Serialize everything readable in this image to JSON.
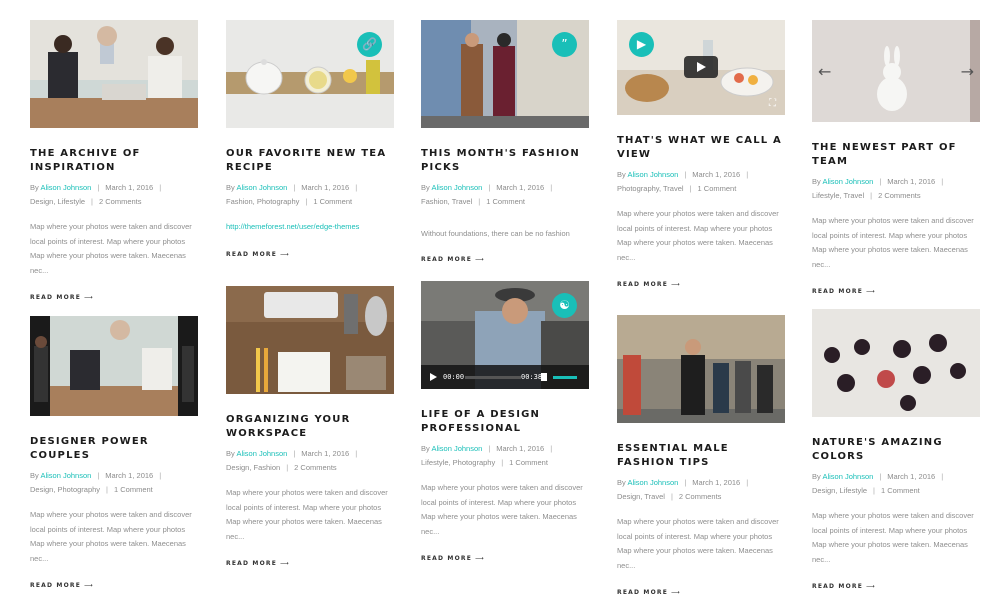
{
  "colors": {
    "accent": "#19bfb8",
    "title": "#1b1b1b",
    "text": "#8f8f8f"
  },
  "posts": [
    {
      "title": "THE ARCHIVE OF INSPIRATION",
      "author": "Alison Johnson",
      "date": "March 1, 2016",
      "categories": "Design, Lifestyle",
      "comments": "2 Comments",
      "excerpt": "Map where your photos were taken and discover local points of interest. Map where your photos Map where your photos were taken. Maecenas nec...",
      "read_more": "READ MORE"
    },
    {
      "title": "OUR FAVORITE NEW TEA RECIPE",
      "author": "Alison Johnson",
      "date": "March 1, 2016",
      "categories": "Fashion, Photography",
      "comments": "1 Comment",
      "link": "http://themeforest.net/user/edge-themes",
      "read_more": "READ MORE",
      "badge_icon": "link-icon"
    },
    {
      "title": "THIS MONTH'S FASHION PICKS",
      "author": "Alison Johnson",
      "date": "March 1, 2016",
      "categories": "Fashion, Travel",
      "comments": "1 Comment",
      "quote": "Without foundations, there can be no fashion",
      "read_more": "READ MORE",
      "badge_icon": "quote-icon"
    },
    {
      "title": "THAT'S WHAT WE CALL A VIEW",
      "author": "Alison Johnson",
      "date": "March 1, 2016",
      "categories": "Photography, Travel",
      "comments": "1 Comment",
      "excerpt": "Map where your photos were taken and discover local points of interest. Map where your photos Map where your photos were taken. Maecenas nec...",
      "read_more": "READ MORE",
      "badge_icon": "video-icon"
    },
    {
      "title": "THE NEWEST PART OF TEAM",
      "author": "Alison Johnson",
      "date": "March 1, 2016",
      "categories": "Lifestyle, Travel",
      "comments": "2 Comments",
      "excerpt": "Map where your photos were taken and discover local points of interest. Map where your photos Map where your photos were taken. Maecenas nec...",
      "read_more": "READ MORE"
    },
    {
      "title": "DESIGNER POWER COUPLES",
      "author": "Alison Johnson",
      "date": "March 1, 2016",
      "categories": "Design, Photography",
      "comments": "1 Comment",
      "excerpt": "Map where your photos were taken and discover local points of interest. Map where your photos Map where your photos were taken. Maecenas nec...",
      "read_more": "READ MORE"
    },
    {
      "title": "ORGANIZING YOUR WORKSPACE",
      "author": "Alison Johnson",
      "date": "March 1, 2016",
      "categories": "Design, Fashion",
      "comments": "2 Comments",
      "excerpt": "Map where your photos were taken and discover local points of interest. Map where your photos Map where your photos were taken. Maecenas nec...",
      "read_more": "READ MORE"
    },
    {
      "title": "LIFE OF A DESIGN PROFESSIONAL",
      "author": "Alison Johnson",
      "date": "March 1, 2016",
      "categories": "Lifestyle, Photography",
      "comments": "1 Comment",
      "excerpt": "Map where your photos were taken and discover local points of interest. Map where your photos Map where your photos were taken. Maecenas nec...",
      "read_more": "READ MORE",
      "badge_icon": "headphones-icon",
      "player": {
        "current": "00:00",
        "duration": "00:38"
      }
    },
    {
      "title": "ESSENTIAL MALE FASHION TIPS",
      "author": "Alison Johnson",
      "date": "March 1, 2016",
      "categories": "Design, Travel",
      "comments": "2 Comments",
      "excerpt": "Map where your photos were taken and discover local points of interest. Map where your photos Map where your photos were taken. Maecenas nec...",
      "read_more": "READ MORE"
    },
    {
      "title": "NATURE'S AMAZING COLORS",
      "author": "Alison Johnson",
      "date": "March 1, 2016",
      "categories": "Design, Lifestyle",
      "comments": "1 Comment",
      "excerpt": "Map where your photos were taken and discover local points of interest. Map where your photos Map where your photos were taken. Maecenas nec...",
      "read_more": "READ MORE"
    }
  ],
  "meta_by": "By"
}
